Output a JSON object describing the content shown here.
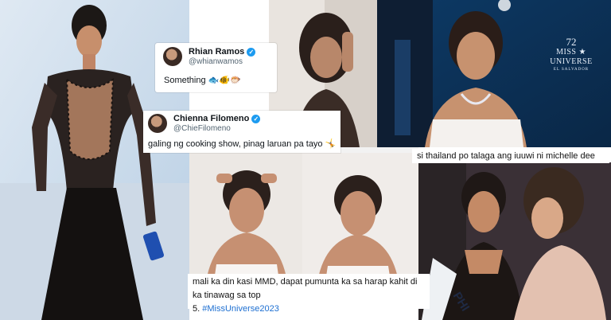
{
  "tweet_rhian": {
    "name": "Rhian Ramos",
    "handle": "@whianwamos",
    "text": "Something 🐟🐠🐡"
  },
  "tweet_chienna": {
    "name": "Chienna Filomeno",
    "handle": "@ChieFilomeno",
    "text": "galing ng cooking show, pinag laruan pa tayo 🤸"
  },
  "caption_thailand": "si thailand po talaga ang iuuwi ni michelle dee",
  "caption_mmd_line1": "mali ka din kasi MMD, dapat pumunta ka sa harap kahit di ka tinawag sa top",
  "caption_mmd_line2_prefix": "5. ",
  "caption_mmd_hashtag": "#MissUniverse2023",
  "stage_logo_number": "72",
  "stage_logo_text": "MISS ★ UNIVERSE",
  "stage_logo_sub": "EL SALVADOR",
  "sash_text": "PHI",
  "colors": {
    "verified_blue": "#1d9bf0",
    "hashtag_blue": "#1d6fd1"
  }
}
